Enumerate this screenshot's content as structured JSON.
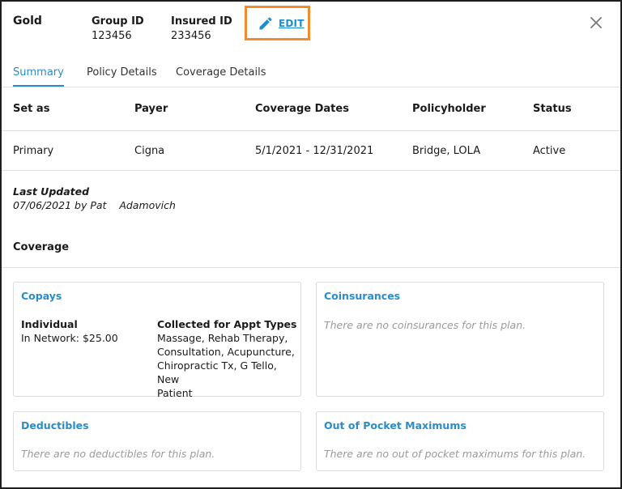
{
  "header": {
    "plan_name": "Gold",
    "group_id_label": "Group ID",
    "group_id_value": "123456",
    "insured_id_label": "Insured ID",
    "insured_id_value": "233456",
    "edit_label": "EDIT"
  },
  "tabs": [
    {
      "label": "Summary",
      "active": true
    },
    {
      "label": "Policy Details",
      "active": false
    },
    {
      "label": "Coverage Details",
      "active": false
    }
  ],
  "table": {
    "headers": [
      "Set as",
      "Payer",
      "Coverage Dates",
      "Policyholder",
      "Status"
    ],
    "row": [
      "Primary",
      "Cigna",
      "5/1/2021 - 12/31/2021",
      "Bridge, LOLA",
      "Active"
    ]
  },
  "last_updated": {
    "title": "Last Updated",
    "text": "07/06/2021 by Pat    Adamovich"
  },
  "coverage": {
    "title": "Coverage",
    "copays": {
      "title": "Copays",
      "individual_label": "Individual",
      "individual_value": "In Network: $25.00",
      "collected_label": "Collected for Appt Types",
      "collected_lines": [
        "Massage, Rehab Therapy,",
        "Consultation, Acupuncture,",
        "Chiropractic Tx, G Tello, New",
        "Patient"
      ]
    },
    "coinsurances": {
      "title": "Coinsurances",
      "empty": "There are no coinsurances for this plan."
    },
    "deductibles": {
      "title": "Deductibles",
      "empty": "There are no deductibles for this plan."
    },
    "oop": {
      "title": "Out of Pocket Maximums",
      "empty": "There are no out of pocket maximums for this plan."
    }
  },
  "icons": {
    "edit": "pencil-icon",
    "close": "close-icon"
  },
  "colors": {
    "accent": "#2a8cc9",
    "highlight_border": "#f28a2e",
    "link": "#1a8fd0",
    "muted_text": "#9a9a9a"
  }
}
